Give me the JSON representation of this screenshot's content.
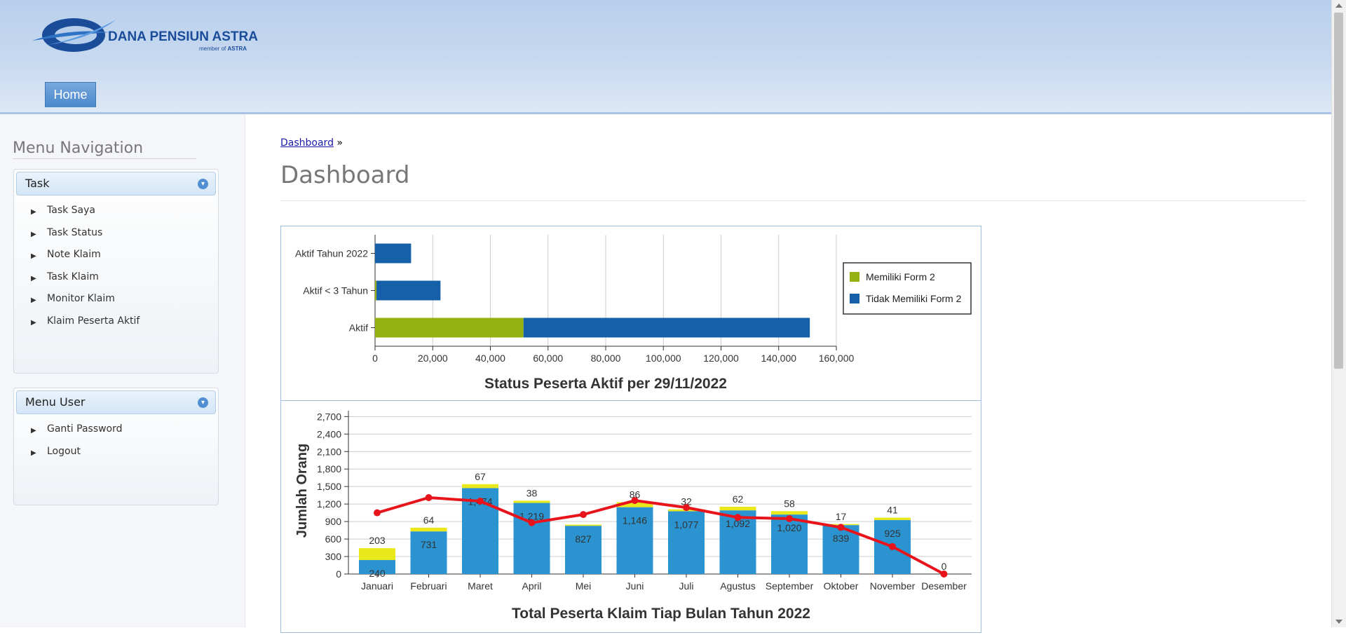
{
  "header": {
    "logo_text": "DANA PENSIUN ASTRA",
    "logo_sub_prefix": "member of ",
    "logo_sub_brand": "ASTRA",
    "nav": [
      {
        "label": "Home"
      }
    ]
  },
  "sidebar": {
    "title": "Menu Navigation",
    "panels": [
      {
        "title": "Task",
        "items": [
          {
            "label": "Task Saya"
          },
          {
            "label": "Task Status"
          },
          {
            "label": "Note Klaim"
          },
          {
            "label": "Task Klaim"
          },
          {
            "label": "Monitor Klaim"
          },
          {
            "label": "Klaim Peserta Aktif"
          }
        ]
      },
      {
        "title": "Menu User",
        "items": [
          {
            "label": "Ganti Password"
          },
          {
            "label": "Logout"
          }
        ]
      }
    ]
  },
  "main": {
    "breadcrumb": {
      "link": "Dashboard",
      "separator": "»"
    },
    "title": "Dashboard"
  },
  "colors": {
    "green": "#94b111",
    "blue": "#1560a8",
    "bar_blue": "#2a93d0",
    "yellow": "#e8e81a",
    "red": "#e8141c"
  },
  "chart_data": [
    {
      "type": "bar",
      "orientation": "horizontal",
      "stacked": true,
      "title": "Status Peserta Aktif per 29/11/2022",
      "categories": [
        "Aktif Tahun 2022",
        "Aktif < 3 Tahun",
        "Aktif"
      ],
      "series": [
        {
          "name": "Memiliki Form 2",
          "color": "#94b111",
          "values": [
            0,
            500,
            51500
          ]
        },
        {
          "name": "Tidak Memiliki Form 2",
          "color": "#1560a8",
          "values": [
            12500,
            22200,
            99300
          ]
        }
      ],
      "xlim": [
        0,
        160000
      ],
      "xticks": [
        "0",
        "20,000",
        "40,000",
        "60,000",
        "80,000",
        "100,000",
        "120,000",
        "140,000",
        "160,000"
      ],
      "grid": true,
      "legend": "right"
    },
    {
      "type": "bar",
      "stacked": true,
      "title": "Total Peserta Klaim Tiap Bulan Tahun 2022",
      "ylabel": "Jumlah Orang",
      "categories": [
        "Januari",
        "Februari",
        "Maret",
        "April",
        "Mei",
        "Juni",
        "Juli",
        "Agustus",
        "September",
        "Oktober",
        "November",
        "Desember"
      ],
      "series": [
        {
          "color": "#2a93d0",
          "values": [
            240,
            731,
            1474,
            1219,
            827,
            1146,
            1077,
            1092,
            1020,
            839,
            925,
            0
          ],
          "labels": [
            "240",
            "731",
            "1,474",
            "1,219",
            "827",
            "1,146",
            "1,077",
            "1,092",
            "1,020",
            "839",
            "925",
            ""
          ]
        },
        {
          "color": "#e8e81a",
          "values": [
            203,
            64,
            67,
            38,
            20,
            86,
            32,
            62,
            58,
            17,
            41,
            0
          ],
          "labels": [
            "203",
            "64",
            "67",
            "38",
            "",
            "86",
            "32",
            "62",
            "58",
            "17",
            "41",
            "0"
          ]
        },
        {
          "type": "line",
          "color": "#e8141c",
          "values": [
            1050,
            1310,
            1250,
            880,
            1020,
            1260,
            1140,
            970,
            950,
            800,
            470,
            0
          ]
        }
      ],
      "ylim": [
        0,
        2800
      ],
      "yticks": [
        "0",
        "300",
        "600",
        "900",
        "1,200",
        "1,500",
        "1,800",
        "2,100",
        "2,400",
        "2,700"
      ],
      "grid": true
    }
  ]
}
